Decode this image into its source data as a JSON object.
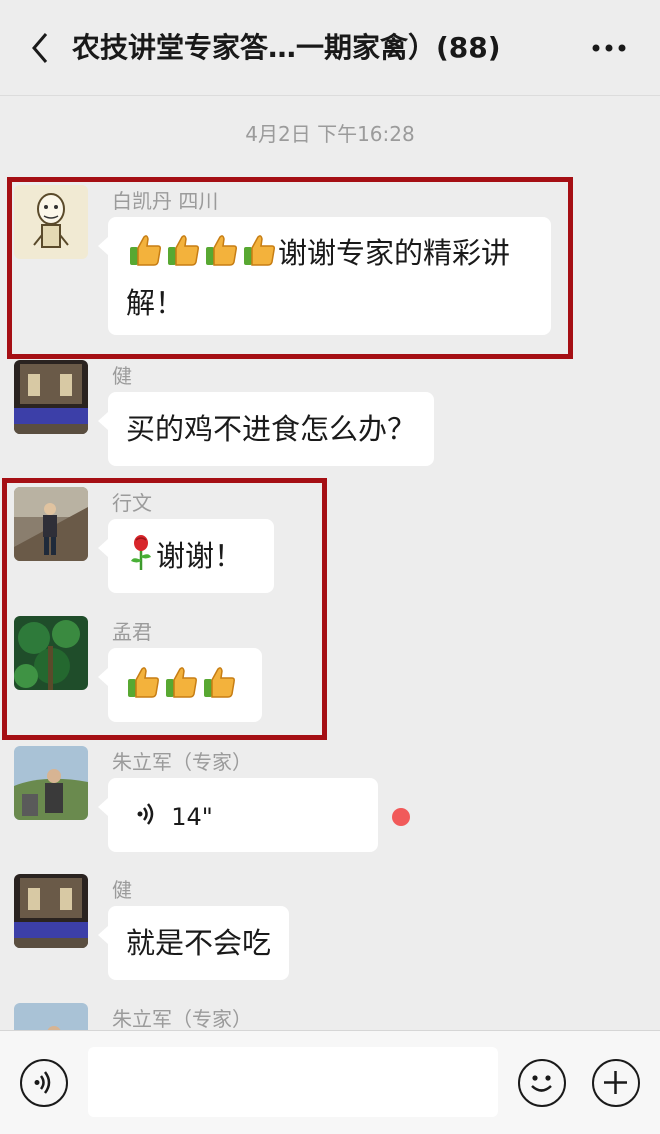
{
  "header": {
    "title": "农技讲堂专家答…一期家禽）(88)"
  },
  "timestamp": "4月2日 下午16:28",
  "messages": [
    {
      "sender": "白凯丹  四川",
      "text": "谢谢专家的精彩讲",
      "text2": "解！"
    },
    {
      "sender": "健",
      "text": "买的鸡不进食怎么办？"
    },
    {
      "sender": "行文",
      "text": "谢谢！"
    },
    {
      "sender": "孟君",
      "text": ""
    },
    {
      "sender": "朱立军（专家）",
      "voice_duration": "14\""
    },
    {
      "sender": "健",
      "text": "就是不会吃"
    },
    {
      "sender": "朱立军（专家）"
    }
  ],
  "icons": {
    "back": "chevron-left-icon",
    "more": "more-dots-icon",
    "voice": "voice-icon",
    "emoji": "smiley-icon",
    "plus": "plus-icon",
    "thumbs": "thumbs-up-icon",
    "rose": "rose-icon"
  },
  "colors": {
    "highlight_box": "#a50f14",
    "unread_dot": "#f15a5a",
    "background": "#ededed"
  }
}
